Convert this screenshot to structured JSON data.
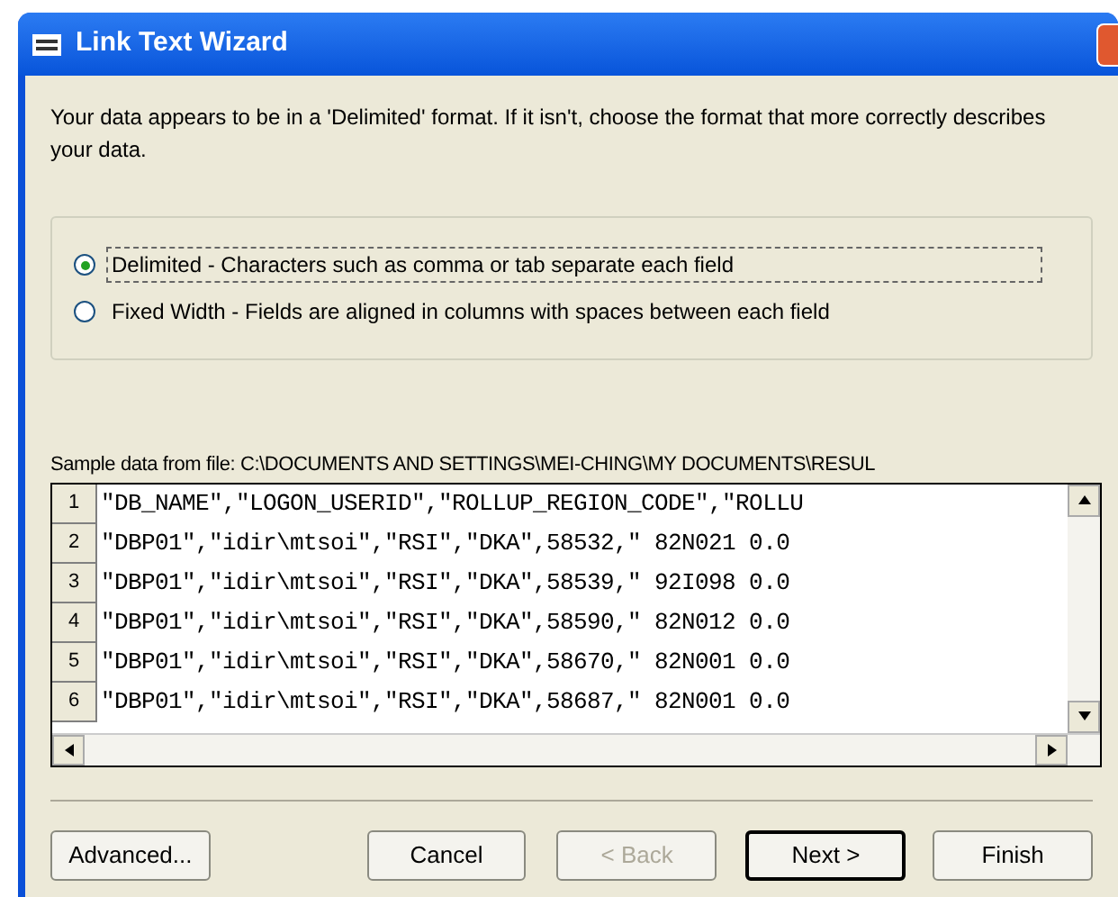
{
  "window": {
    "title": "Link Text Wizard"
  },
  "intro": "Your data appears to be in a 'Delimited' format. If it isn't, choose the format that more correctly describes your data.",
  "formats": [
    {
      "label": "Delimited - Characters such as comma or tab separate each field",
      "selected": true
    },
    {
      "label": "Fixed Width - Fields are aligned in columns with spaces between each field",
      "selected": false
    }
  ],
  "sample": {
    "label": "Sample data from file: C:\\DOCUMENTS AND SETTINGS\\MEI-CHING\\MY DOCUMENTS\\RESUL",
    "rows": [
      {
        "number": "1",
        "text": "\"DB_NAME\",\"LOGON_USERID\",\"ROLLUP_REGION_CODE\",\"ROLLU"
      },
      {
        "number": "2",
        "text": "\"DBP01\",\"idir\\mtsoi\",\"RSI\",\"DKA\",58532,\" 82N021 0.0"
      },
      {
        "number": "3",
        "text": "\"DBP01\",\"idir\\mtsoi\",\"RSI\",\"DKA\",58539,\" 92I098 0.0"
      },
      {
        "number": "4",
        "text": "\"DBP01\",\"idir\\mtsoi\",\"RSI\",\"DKA\",58590,\" 82N012 0.0"
      },
      {
        "number": "5",
        "text": "\"DBP01\",\"idir\\mtsoi\",\"RSI\",\"DKA\",58670,\" 82N001 0.0"
      },
      {
        "number": "6",
        "text": "\"DBP01\",\"idir\\mtsoi\",\"RSI\",\"DKA\",58687,\" 82N001 0.0"
      }
    ]
  },
  "buttons": [
    {
      "label": "Advanced...",
      "disabled": false,
      "default": false
    },
    {
      "label": "Cancel",
      "disabled": false,
      "default": false
    },
    {
      "label": "< Back",
      "disabled": true,
      "default": false
    },
    {
      "label": "Next >",
      "disabled": false,
      "default": true
    },
    {
      "label": "Finish",
      "disabled": false,
      "default": false
    }
  ]
}
